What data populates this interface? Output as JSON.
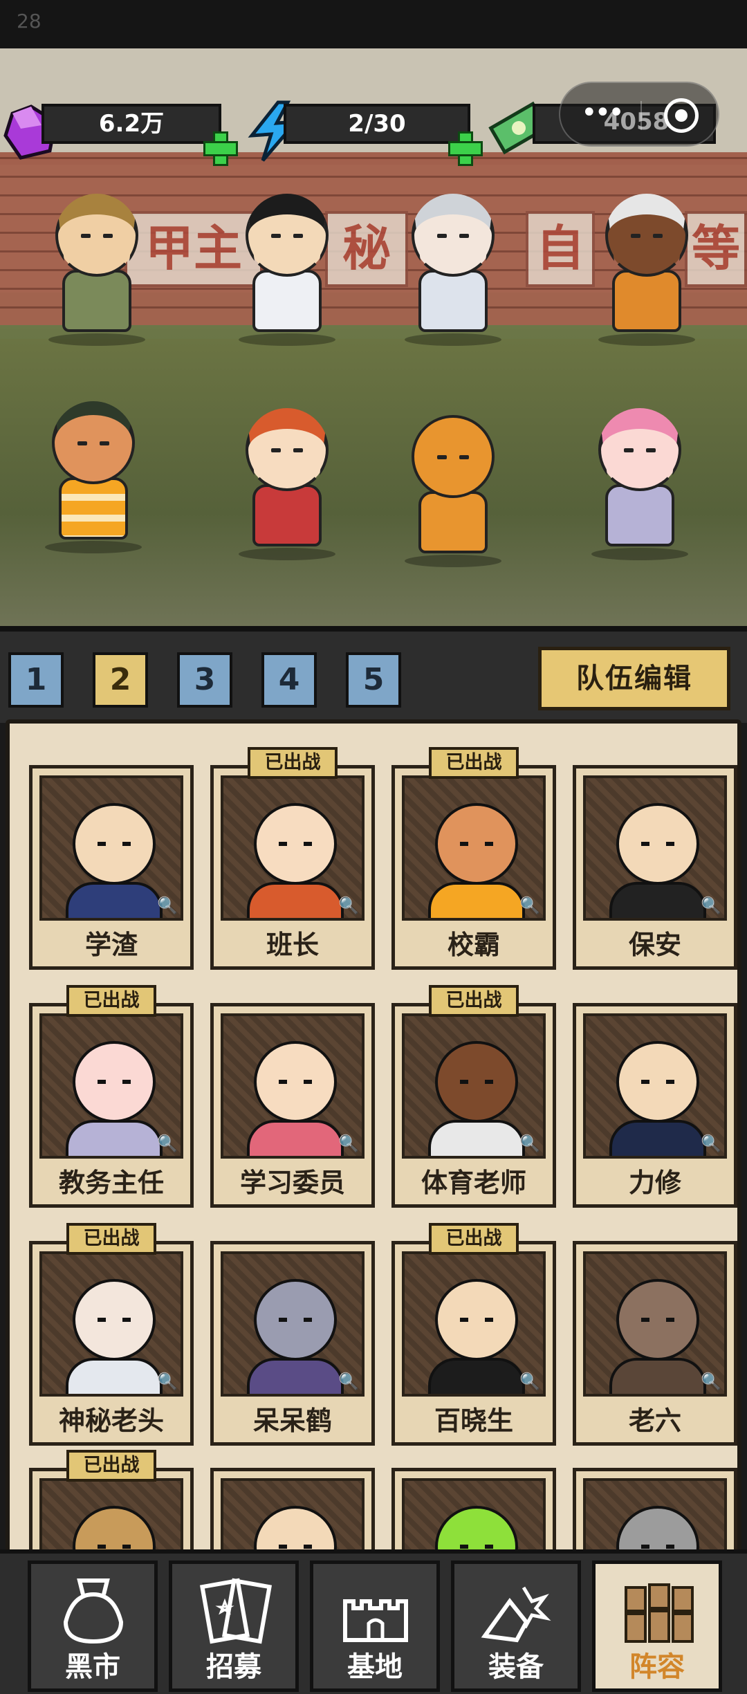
{
  "status": {
    "time": "28"
  },
  "resources": {
    "gems": "6.2万",
    "energy": "2/30",
    "money": "4058"
  },
  "scene": {
    "wall_signs": [
      "甲主",
      "秘",
      "自",
      "等"
    ]
  },
  "team_tabs": [
    "1",
    "2",
    "3",
    "4",
    "5"
  ],
  "team_tabs_active": "2",
  "edit_button": "队伍编辑",
  "deployed_label": "已出战",
  "roster": [
    {
      "name": "学渣",
      "deployed": false,
      "color": "#f3d9b8",
      "outfit": "#2e3e7a"
    },
    {
      "name": "班长",
      "deployed": true,
      "color": "#f7dcc0",
      "outfit": "#d85b2d"
    },
    {
      "name": "校霸",
      "deployed": true,
      "color": "#e0935c",
      "outfit": "#f5a623"
    },
    {
      "name": "保安",
      "deployed": false,
      "color": "#f3d9b8",
      "outfit": "#222222"
    },
    {
      "name": "教务主任",
      "deployed": true,
      "color": "#fbd9d4",
      "outfit": "#b6b2d6"
    },
    {
      "name": "学习委员",
      "deployed": false,
      "color": "#f7dcc0",
      "outfit": "#e2677a"
    },
    {
      "name": "体育老师",
      "deployed": true,
      "color": "#7d4a2c",
      "outfit": "#e8e8e8"
    },
    {
      "name": "力修",
      "deployed": false,
      "color": "#f3d9b8",
      "outfit": "#1f2a4a"
    },
    {
      "name": "神秘老头",
      "deployed": true,
      "color": "#f3e6dc",
      "outfit": "#e4e8ee"
    },
    {
      "name": "呆呆鹤",
      "deployed": false,
      "color": "#9a9cb0",
      "outfit": "#5a4c86"
    },
    {
      "name": "百晓生",
      "deployed": true,
      "color": "#f3d9b8",
      "outfit": "#1c1c1c"
    },
    {
      "name": "老六",
      "deployed": false,
      "color": "#8c7160",
      "outfit": "#5a4638"
    },
    {
      "name": "",
      "deployed": true,
      "color": "#c89b5a",
      "outfit": "#6d7a4d"
    },
    {
      "name": "",
      "deployed": false,
      "color": "#f3d9b8",
      "outfit": "#2a2a2a"
    },
    {
      "name": "",
      "deployed": false,
      "color": "#8ee03a",
      "outfit": "#6fb82a"
    },
    {
      "name": "",
      "deployed": false,
      "color": "#9c9c9c",
      "outfit": "#3c3c3c"
    }
  ],
  "nav": [
    {
      "label": "黑市",
      "icon": "bag-icon",
      "active": false
    },
    {
      "label": "招募",
      "icon": "cards-icon",
      "active": false
    },
    {
      "label": "基地",
      "icon": "castle-icon",
      "active": false
    },
    {
      "label": "装备",
      "icon": "weapon-icon",
      "active": false
    },
    {
      "label": "阵容",
      "icon": "team-icon",
      "active": true
    }
  ]
}
